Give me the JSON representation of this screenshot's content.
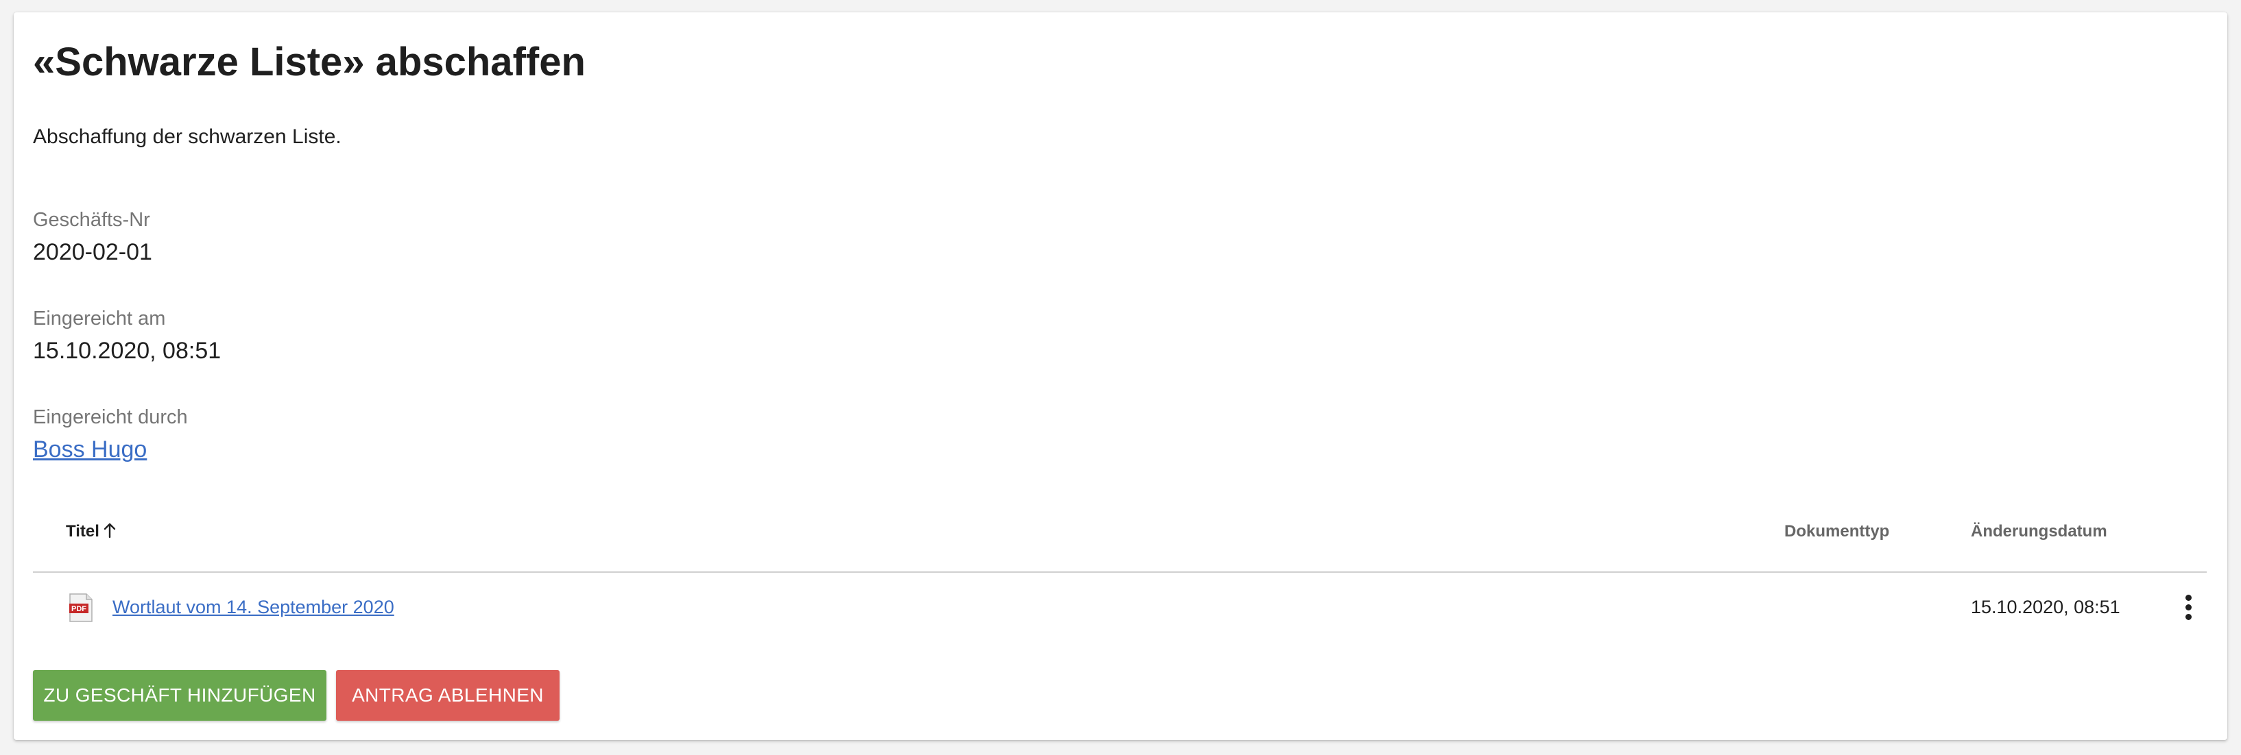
{
  "page": {
    "title": "«Schwarze Liste» abschaffen",
    "description": "Abschaffung der schwarzen Liste."
  },
  "fields": {
    "business_number": {
      "label": "Geschäfts-Nr",
      "value": "2020-02-01"
    },
    "submitted_at": {
      "label": "Eingereicht am",
      "value": "15.10.2020, 08:51"
    },
    "submitted_by": {
      "label": "Eingereicht durch",
      "value": "Boss Hugo"
    }
  },
  "table": {
    "headers": {
      "title": "Titel",
      "document_type": "Dokumenttyp",
      "change_date": "Änderungsdatum"
    },
    "sort": {
      "column": "title",
      "direction": "ascending",
      "icon": "arrow-up-icon"
    },
    "rows": [
      {
        "icon": "pdf-file-icon",
        "icon_text": "PDF",
        "title": "Wortlaut vom 14. September 2020",
        "document_type": "",
        "change_date": "15.10.2020, 08:51",
        "actions_icon": "more-vertical-icon"
      }
    ]
  },
  "actions": {
    "add_to_business": "ZU GESCHÄFT HINZUFÜGEN",
    "reject_motion": "ANTRAG ABLEHNEN"
  },
  "colors": {
    "link": "#3a6dc5",
    "add_button": "#6aa84f",
    "reject_button": "#dd5c57",
    "pdf_icon": "#c62828"
  }
}
